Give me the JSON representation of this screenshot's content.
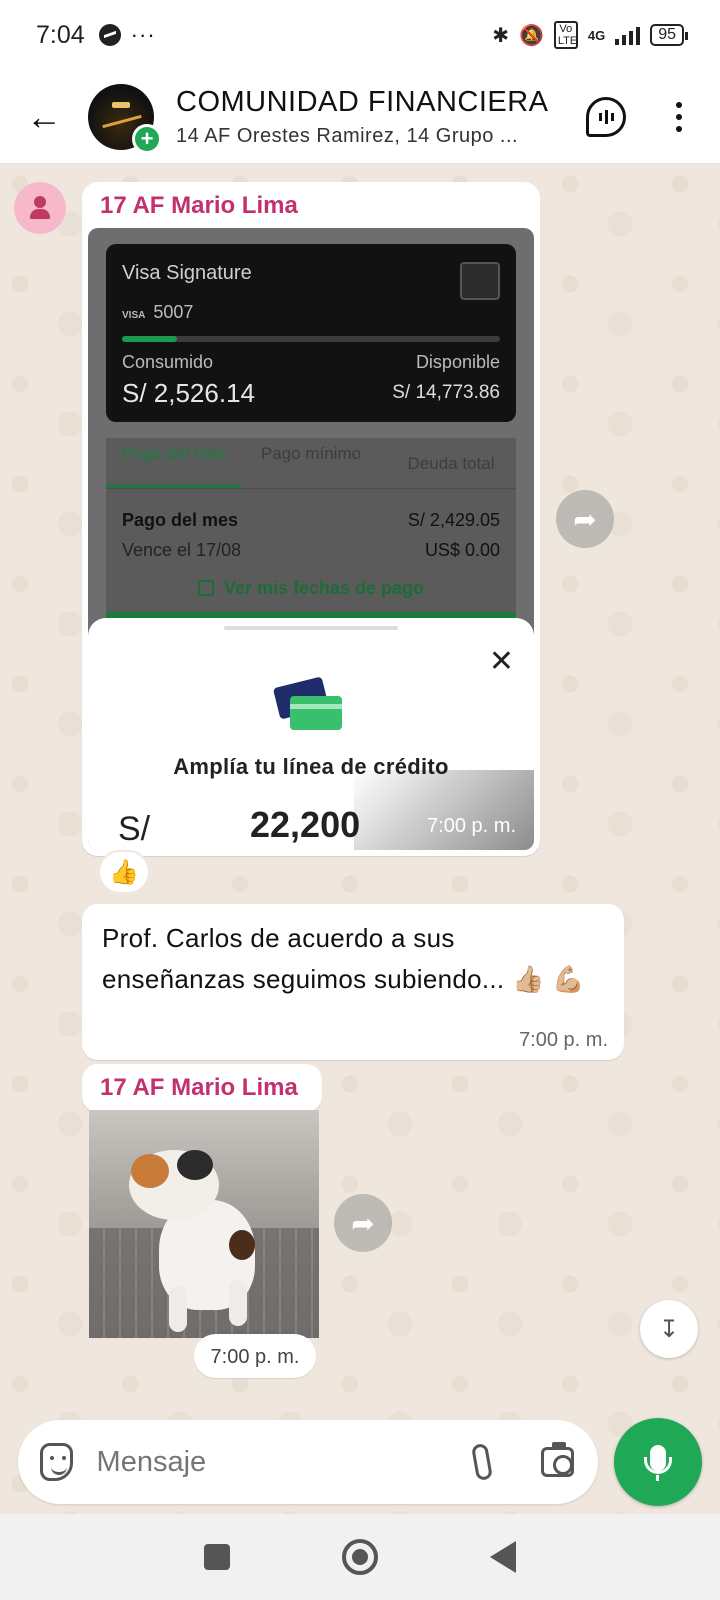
{
  "status_bar": {
    "time": "7:04",
    "more": "···",
    "network": "4G",
    "volte": "Vo LTE",
    "battery": "95"
  },
  "header": {
    "title": "COMUNIDAD FINANCIERA",
    "subtitle": "14 AF Orestes Ramirez, 14 Grupo ...",
    "back_icon": "arrow-back-icon",
    "call_icon": "voice-chat-icon",
    "menu_icon": "more-vert-icon"
  },
  "messages": {
    "msg1": {
      "sender": "17 AF Mario Lima",
      "time": "7:00 p. m.",
      "reaction": "👍",
      "screenshot": {
        "card_name": "Visa Signature",
        "card_brand": "VISA",
        "card_last4": "5007",
        "consumed_fraction": 0.146,
        "consumido_label": "Consumido",
        "consumido_value": "S/ 2,526.14",
        "disponible_label": "Disponible",
        "disponible_value": "S/ 14,773.86",
        "tabs": [
          "Pago del mes",
          "Pago mínimo",
          "Deuda total"
        ],
        "pago_label": "Pago del mes",
        "pago_value": "S/ 2,429.05",
        "vence_label": "Vence el 17/08",
        "vence_value": "US$ 0.00",
        "fechas_link": "Ver mis fechas de pago",
        "sheet_title": "Amplía tu línea de crédito",
        "sheet_currency": "S/",
        "sheet_amount": "22,200"
      }
    },
    "msg2": {
      "text": "Prof. Carlos de acuerdo a sus enseñanzas seguimos subiendo... 👍🏼 💪🏼",
      "time": "7:00 p. m."
    },
    "msg3": {
      "sender": "17 AF Mario Lima",
      "time": "7:00 p. m."
    }
  },
  "composer": {
    "placeholder": "Mensaje"
  },
  "colors": {
    "accent": "#1fa855",
    "sender_name": "#c2306e",
    "wallpaper": "#efe7dd"
  }
}
